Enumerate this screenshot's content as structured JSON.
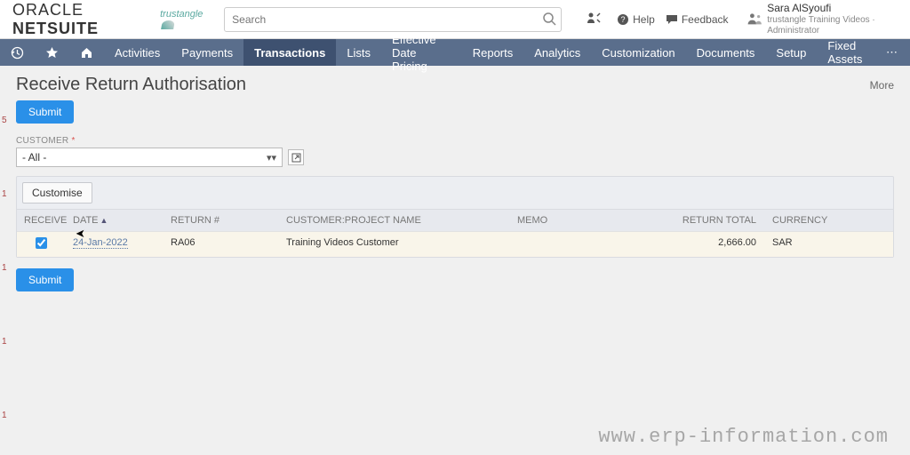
{
  "header": {
    "logo_text_a": "ORACLE",
    "logo_text_b": " NETSUITE",
    "partner_text": "trustangle",
    "search_placeholder": "Search",
    "help_label": "Help",
    "feedback_label": "Feedback",
    "user_name": "Sara AlSyoufi",
    "user_role": "trustangle Training Videos · Administrator"
  },
  "nav": {
    "items": [
      "Activities",
      "Payments",
      "Transactions",
      "Lists",
      "Effective Date Pricing",
      "Reports",
      "Analytics",
      "Customization",
      "Documents",
      "Setup",
      "Fixed Assets"
    ],
    "active_index": 2,
    "more_glyph": "⋯"
  },
  "page": {
    "title": "Receive Return Authorisation",
    "more_label": "More",
    "submit_label": "Submit",
    "customer_label": "CUSTOMER",
    "customer_value": "- All -",
    "customise_label": "Customise"
  },
  "table": {
    "columns": {
      "receive": "RECEIVE",
      "date": "DATE",
      "return_no": "RETURN #",
      "customer": "CUSTOMER:PROJECT NAME",
      "memo": "MEMO",
      "return_total": "RETURN TOTAL",
      "currency": "CURRENCY"
    },
    "rows": [
      {
        "receive": true,
        "date": "24-Jan-2022",
        "return_no": "RA06",
        "customer": "Training Videos Customer",
        "memo": "",
        "return_total": "2,666.00",
        "currency": "SAR"
      }
    ]
  },
  "left_marks": [
    "5",
    "1",
    "1",
    "1",
    "1"
  ],
  "watermark": "www.erp-information.com"
}
